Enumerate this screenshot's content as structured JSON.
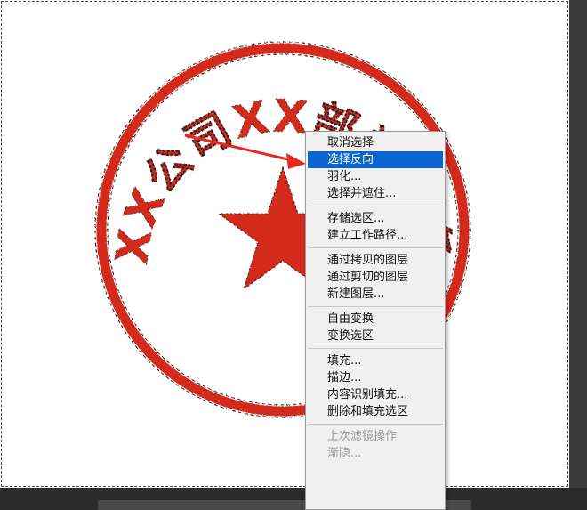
{
  "stamp": {
    "text": "XX公司XX部门财务",
    "color": "#d42a1e"
  },
  "context_menu": {
    "groups": [
      [
        {
          "label": "取消选择",
          "highlighted": false,
          "disabled": false
        },
        {
          "label": "选择反向",
          "highlighted": true,
          "disabled": false
        },
        {
          "label": "羽化...",
          "highlighted": false,
          "disabled": false
        },
        {
          "label": "选择并遮住...",
          "highlighted": false,
          "disabled": false
        }
      ],
      [
        {
          "label": "存储选区...",
          "highlighted": false,
          "disabled": false
        },
        {
          "label": "建立工作路径...",
          "highlighted": false,
          "disabled": false
        }
      ],
      [
        {
          "label": "通过拷贝的图层",
          "highlighted": false,
          "disabled": false
        },
        {
          "label": "通过剪切的图层",
          "highlighted": false,
          "disabled": false
        },
        {
          "label": "新建图层...",
          "highlighted": false,
          "disabled": false
        }
      ],
      [
        {
          "label": "自由变换",
          "highlighted": false,
          "disabled": false
        },
        {
          "label": "变换选区",
          "highlighted": false,
          "disabled": false
        }
      ],
      [
        {
          "label": "填充...",
          "highlighted": false,
          "disabled": false
        },
        {
          "label": "描边...",
          "highlighted": false,
          "disabled": false
        },
        {
          "label": "内容识别填充...",
          "highlighted": false,
          "disabled": false
        },
        {
          "label": "删除和填充选区",
          "highlighted": false,
          "disabled": false
        }
      ],
      [
        {
          "label": "上次滤镜操作",
          "highlighted": false,
          "disabled": true
        },
        {
          "label": "渐隐...",
          "highlighted": false,
          "disabled": true
        }
      ]
    ]
  },
  "colors": {
    "highlight": "#0a64d2",
    "arrow": "#e8281e"
  }
}
